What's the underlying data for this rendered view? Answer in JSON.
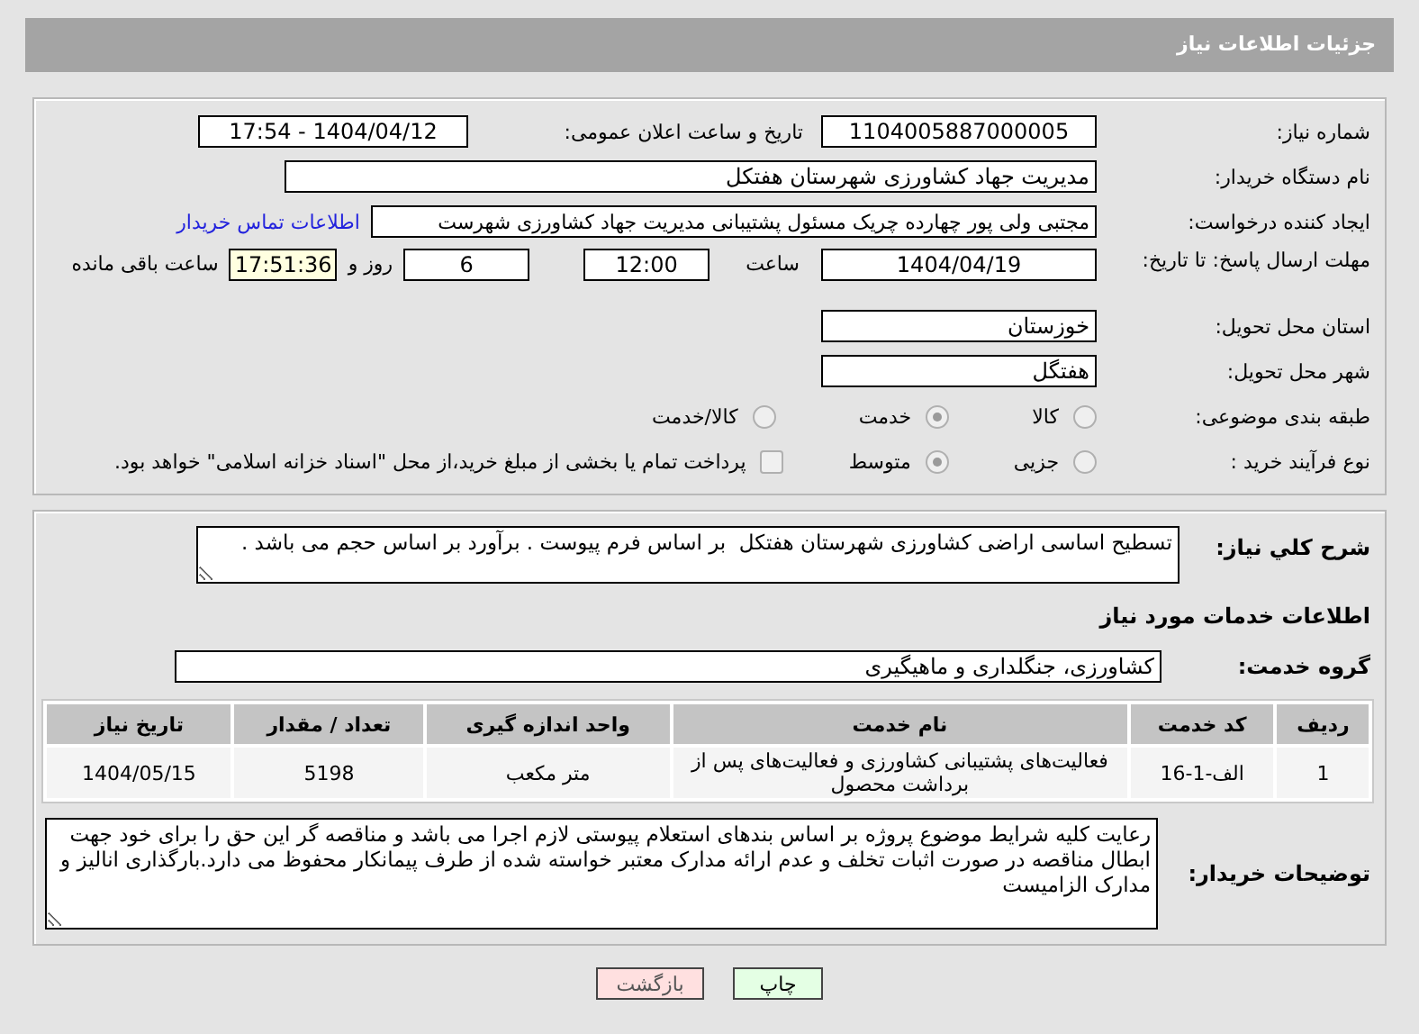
{
  "header": {
    "title": "جزئیات اطلاعات نیاز"
  },
  "need_number": {
    "label": "شماره نیاز:",
    "value": "1104005887000005"
  },
  "announce": {
    "label": "تاریخ و ساعت اعلان عمومی:",
    "value": "1404/04/12 - 17:54"
  },
  "buyer": {
    "label": "نام دستگاه خریدار:",
    "value": "مدیریت جهاد کشاورزی شهرستان هفتکل"
  },
  "creator": {
    "label": "ایجاد کننده درخواست:",
    "value": "مجتبی ولی پور چهارده چریک مسئول پشتیبانی مدیریت جهاد کشاورزی شهرست",
    "link": "اطلاعات تماس خریدار"
  },
  "deadline": {
    "label": "مهلت ارسال پاسخ: تا تاریخ:",
    "date": "1404/04/19",
    "time_label": "ساعت",
    "time": "12:00",
    "days": "6",
    "days_label": "روز و",
    "remaining": "17:51:36",
    "remaining_label": "ساعت باقی مانده"
  },
  "province": {
    "label": "استان محل تحویل:",
    "value": "خوزستان"
  },
  "city": {
    "label": "شهر محل تحویل:",
    "value": "هفتگل"
  },
  "category": {
    "label": "طبقه بندی موضوعی:",
    "options": [
      {
        "label": "کالا",
        "selected": false
      },
      {
        "label": "خدمت",
        "selected": true
      },
      {
        "label": "کالا/خدمت",
        "selected": false
      }
    ]
  },
  "purchase_type": {
    "label": "نوع فرآیند خرید :",
    "options": [
      {
        "label": "جزیی",
        "selected": false
      },
      {
        "label": "متوسط",
        "selected": true
      }
    ],
    "payment_note": {
      "text": "پرداخت تمام یا بخشی از مبلغ خرید،از محل \"اسناد خزانه اسلامی\" خواهد بود.",
      "checked": false
    }
  },
  "description": {
    "label": "شرح کلي نياز:",
    "value": "تسطیح اساسی اراضی کشاورزی شهرستان هفتکل  بر اساس فرم پیوست . برآورد بر اساس حجم می باشد ."
  },
  "services_heading": "اطلاعات خدمات مورد نیاز",
  "service_group": {
    "label": "گروه خدمت:",
    "value": "کشاورزی، جنگلداری و ماهیگیری"
  },
  "table": {
    "columns": [
      "ردیف",
      "کد خدمت",
      "نام خدمت",
      "واحد اندازه گیری",
      "تعداد / مقدار",
      "تاریخ نیاز"
    ],
    "rows": [
      [
        "1",
        "الف-1-16",
        "فعالیت‌های پشتیبانی کشاورزی و فعالیت‌های پس از برداشت محصول",
        "متر مکعب",
        "5198",
        "1404/05/15"
      ]
    ]
  },
  "buyer_notes": {
    "label": "توضیحات خریدار:",
    "value": "رعایت کلیه شرایط موضوع پروژه بر اساس بندهای استعلام پیوستی لازم اجرا می باشد و مناقصه گر این حق را برای خود جهت ابطال مناقصه در صورت اثبات تخلف و عدم ارائه مدارک معتبر خواسته شده از طرف پیمانکار محفوظ می دارد.بارگذاری انالیز و مدارک الزامیست"
  },
  "buttons": [
    {
      "label": "چاپ",
      "kind": "print"
    },
    {
      "label": "بازگشت",
      "kind": "back"
    }
  ]
}
